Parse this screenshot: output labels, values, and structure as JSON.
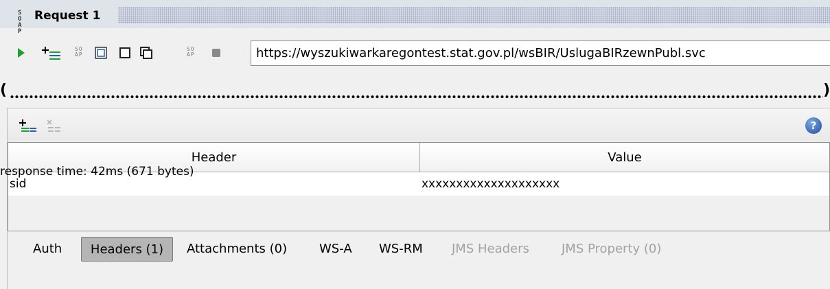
{
  "window": {
    "title": "Request 1",
    "soap_icon_text": "SO AP"
  },
  "toolbar": {
    "url": "https://wyszukiwarkaregontest.stat.gov.pl/wsBIR/UslugaBIRzewnPubl.svc",
    "icons": [
      "run-icon",
      "add-step-icon",
      "soap-icon",
      "clone-icon",
      "box-icon",
      "copy-icon",
      "soap-icon",
      "stop-icon"
    ]
  },
  "content": {
    "open_paren": "(",
    "close_paren": ")"
  },
  "headers_panel": {
    "columns": [
      "Header",
      "Value"
    ],
    "rows": [
      {
        "header": "sid",
        "value": "xxxxxxxxxxxxxxxxxxxx"
      }
    ]
  },
  "tabs": [
    {
      "label": "Auth",
      "enabled": true,
      "selected": false
    },
    {
      "label": "Headers (1)",
      "enabled": true,
      "selected": true
    },
    {
      "label": "Attachments (0)",
      "enabled": true,
      "selected": false
    },
    {
      "label": "WS-A",
      "enabled": true,
      "selected": false
    },
    {
      "label": "WS-RM",
      "enabled": true,
      "selected": false
    },
    {
      "label": "JMS Headers",
      "enabled": false,
      "selected": false
    },
    {
      "label": "JMS Property (0)",
      "enabled": false,
      "selected": false
    }
  ],
  "status": {
    "text": "response time: 42ms (671 bytes)"
  },
  "colors": {
    "run_green": "#1e9e34",
    "accent_blue": "#2a5db0",
    "disabled_text": "#a2a2a2"
  }
}
